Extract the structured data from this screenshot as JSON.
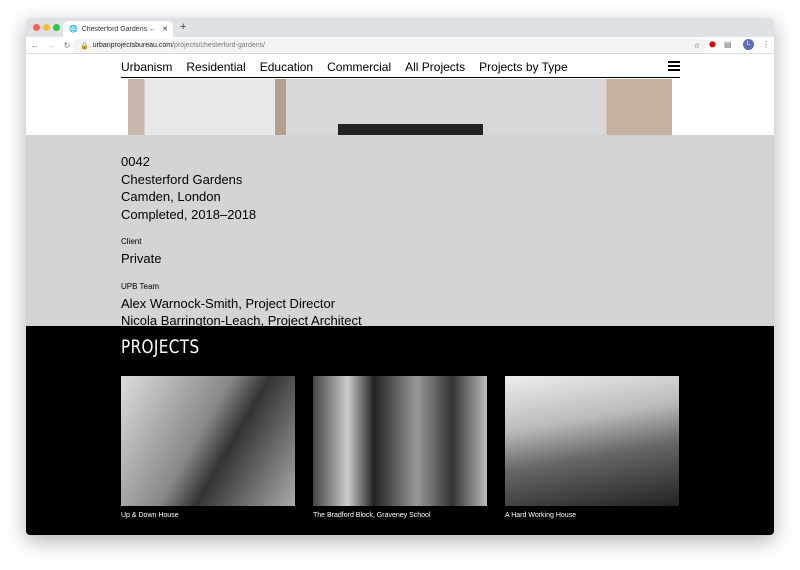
{
  "browser": {
    "tab_title": "Chesterford Gardens ← Projects",
    "url_domain": "urbanprojectsbureau.com",
    "url_path": "/projects/chesterford-gardens/",
    "profile_initial": "L"
  },
  "nav": {
    "items": [
      "Urbanism",
      "Residential",
      "Education",
      "Commercial",
      "All Projects",
      "Projects by Type"
    ]
  },
  "project": {
    "number": "0042",
    "name": "Chesterford Gardens",
    "location": "Camden, London",
    "status": "Completed, 2018–2018",
    "client_label": "Client",
    "client": "Private",
    "team_label": "UPB Team",
    "team": [
      "Alex Warnock-Smith, Project Director",
      "Nicola Barrington-Leach, Project Architect"
    ]
  },
  "projects": {
    "title": "PROJECTS",
    "items": [
      {
        "caption": "Up & Down House"
      },
      {
        "caption": "The Bradford Block, Graveney School"
      },
      {
        "caption": "A Hard Working House"
      }
    ]
  }
}
